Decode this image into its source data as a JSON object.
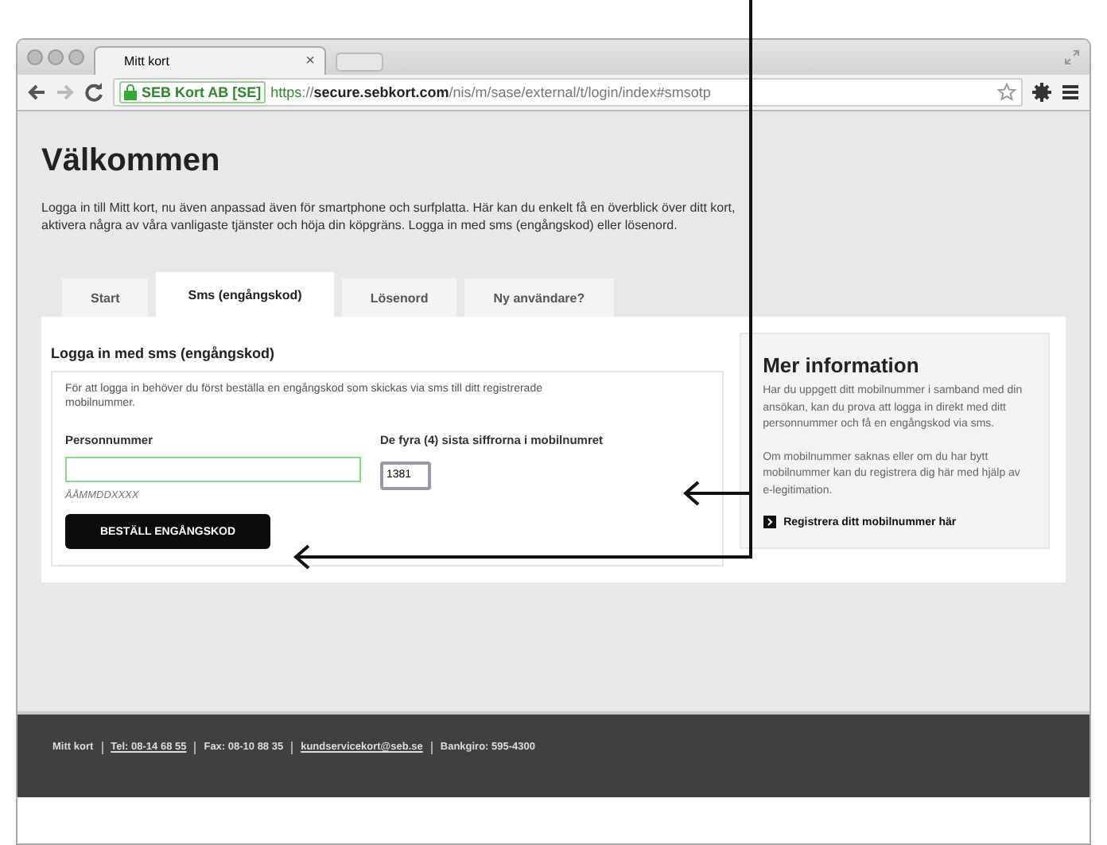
{
  "browser": {
    "tab_title": "Mitt kort",
    "close": "×",
    "site_identity": "SEB Kort AB [SE]",
    "url_scheme": "https",
    "url_separator": "://",
    "url_host": "secure.sebkort.com",
    "url_path": "/nis/m/sase/external/t/login/index#smsotp"
  },
  "page": {
    "title": "Välkommen",
    "intro": "Logga in till Mitt kort, nu även anpassad även för smartphone och surfplatta. Här kan du enkelt få en överblick över ditt kort, aktivera några av våra vanligaste tjänster och höja din köpgräns. Logga in med sms (engångskod) eller lösenord."
  },
  "tabs": [
    {
      "label": "Start",
      "selected": false
    },
    {
      "label": "Sms (engångskod)",
      "selected": true
    },
    {
      "label": "Lösenord",
      "selected": false
    },
    {
      "label": "Ny användare?",
      "selected": false
    }
  ],
  "form": {
    "heading": "Logga in med sms (engångskod)",
    "description": "För att logga in behöver du först beställa en engångskod som skickas via sms till ditt registrerade mobilnummer.",
    "personnummer_label": "Personnummer",
    "personnummer_hint": "ÅÅMMDDXXXX",
    "digits_label": "De fyra (4) sista siffrorna i mobilnumret",
    "digits_value": "1381",
    "submit": "BESTÄLL ENGÅNGSKOD"
  },
  "info": {
    "heading": "Mer information",
    "paragraphs": [
      "Har du uppgett ditt mobilnummer i samband med din ansökan, kan du prova att logga in direkt med ditt personnummer och få en engångskod via sms.",
      "Om mobilnummer saknas eller om du har bytt mobilnummer kan du registrera dig här med hjälp av e-legitimation."
    ],
    "link": "Registrera ditt mobilnummer här"
  },
  "footer": [
    {
      "text": "Mitt kort",
      "kind": "text"
    },
    {
      "text": "Tel: 08-14 68 55",
      "kind": "link"
    },
    {
      "text": "Fax: 08-10 88 35",
      "kind": "text"
    },
    {
      "text": "kundservicekort@seb.se",
      "kind": "link"
    },
    {
      "text": "Bankgiro: 595-4300",
      "kind": "text"
    }
  ]
}
